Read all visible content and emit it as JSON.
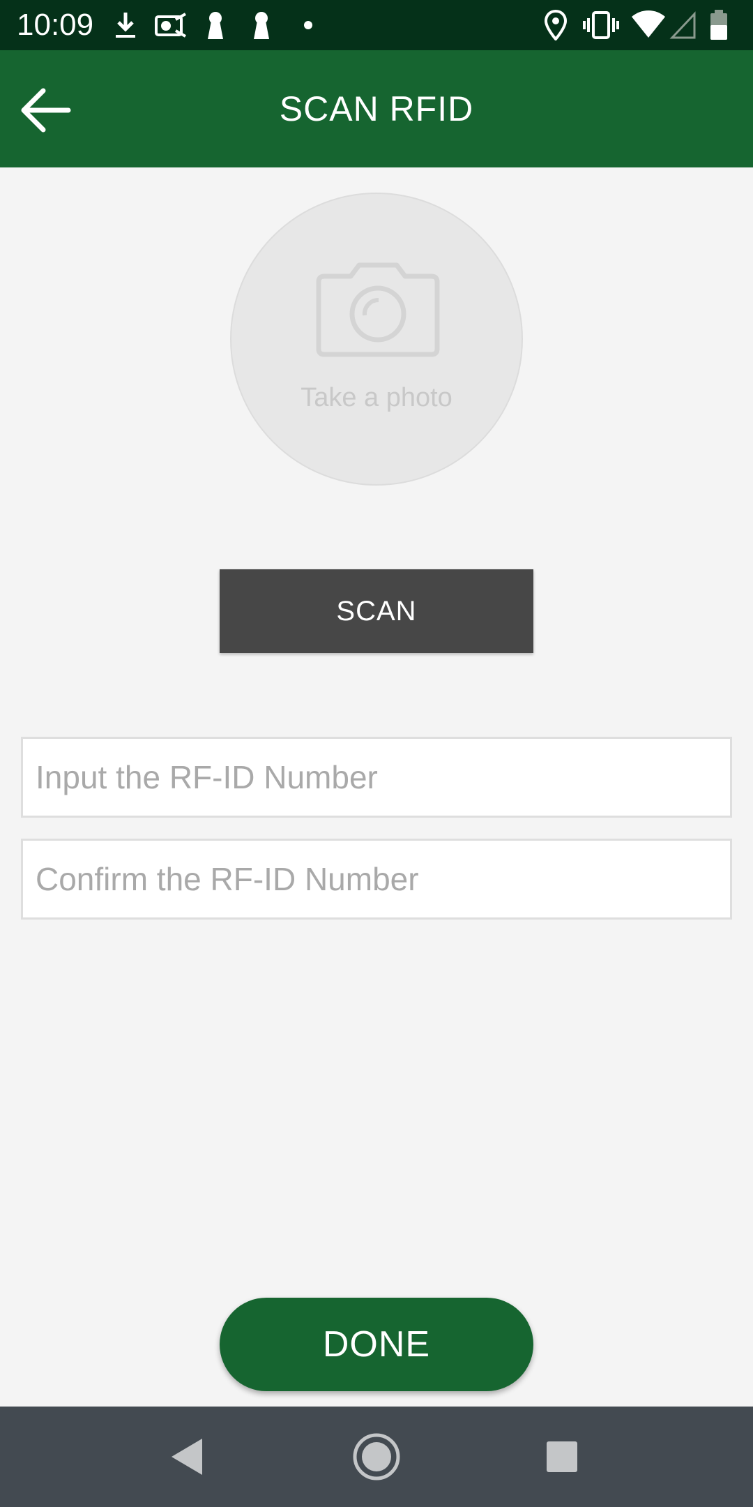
{
  "status_bar": {
    "time": "10:09",
    "left_icons": [
      "download-icon",
      "cast-icon",
      "keyhole-icon",
      "keyhole-icon",
      "dot-icon"
    ],
    "right_icons": [
      "location-icon",
      "vibrate-icon",
      "wifi-icon",
      "signal-icon",
      "battery-icon"
    ]
  },
  "app_bar": {
    "title": "SCAN RFID",
    "back_icon": "arrow-left-icon",
    "background": "#166530"
  },
  "photo": {
    "label": "Take a photo",
    "icon": "camera-icon"
  },
  "scan_button": {
    "label": "SCAN",
    "background": "#474747"
  },
  "fields": {
    "rfid_input": {
      "value": "",
      "placeholder": "Input the RF-ID Number"
    },
    "rfid_confirm": {
      "value": "",
      "placeholder": "Confirm the RF-ID Number"
    }
  },
  "done_button": {
    "label": "DONE",
    "background": "#166530"
  },
  "nav_bar": {
    "icons": [
      "nav-back-icon",
      "nav-home-icon",
      "nav-recents-icon"
    ]
  }
}
